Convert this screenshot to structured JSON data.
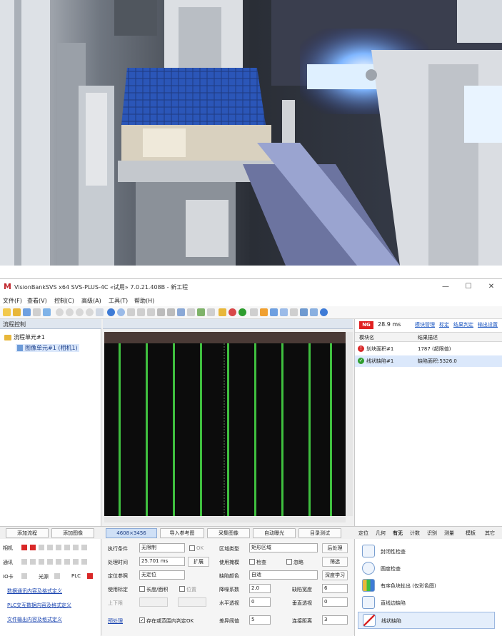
{
  "colors": {
    "ng_red": "#e02020",
    "ok_green": "#2e9d2e",
    "link_blue": "#1a44b0",
    "stripe_green": "#3fbf3f"
  },
  "photo": {
    "alt_icon": "machine-photo"
  },
  "window": {
    "title": "VisionBankSVS x64 SVS-PLUS-4C «试用» 7.0.21.408B - 新工程",
    "controls": [
      "—",
      "☐",
      "✕"
    ]
  },
  "menu": [
    "文件(F)",
    "查看(V)",
    "控制(C)",
    "高级(A)",
    "工具(T)",
    "帮助(H)"
  ],
  "left_panel": {
    "header": "流程控制",
    "tree_root": "流程单元#1",
    "tree_child": "图像单元#1 (相机1)"
  },
  "results": {
    "status": "NG",
    "time": "28.9 ms",
    "links": [
      "模块管理",
      "标定",
      "结果判定",
      "输出设置"
    ],
    "col_name": "模块名",
    "col_desc": "结果描述",
    "rows": [
      {
        "name": "划块面积#1",
        "value": "1787 (超限值)",
        "state": "ng"
      },
      {
        "name": "线状缺陷#1",
        "value": "缺陷面积:5326.0",
        "state": "ok"
      }
    ]
  },
  "bottom_bar": {
    "add_flow": "添加流程",
    "add_image": "添加图像",
    "resolution": "4608×3456",
    "import_ref": "导入参考图",
    "capture": "采集图像",
    "auto_exposure": "自动曝光",
    "dir_test": "目录测试",
    "tabs": [
      "定位",
      "几何",
      "有无",
      "计数",
      "识别",
      "测量",
      "模板",
      "其它"
    ]
  },
  "status": {
    "camera": "相机",
    "comm": "通讯",
    "io": "IO卡",
    "light": "光源",
    "plc": "PLC",
    "links": [
      "数据通讯内容及格式定义",
      "PLC交互数据内容及格式定义",
      "文件输出内容及格式定义"
    ]
  },
  "params": {
    "exec_cond_label": "执行条件",
    "exec_cond_value": "无限制",
    "ok_label": "OK",
    "time_label": "处理时间",
    "time_value": "25.701 ms",
    "expand_button": "扩展",
    "locate_ref_label": "定位参照",
    "locate_ref_value": "无定位",
    "use_calib_label": "使用标定",
    "calib_opt1": "长度/面积",
    "calib_opt2": "位置",
    "limits_label": "上下限",
    "pre_process": "预处理",
    "draw_in_range": "存在或范围内判定OK",
    "region_type_label": "区域类型",
    "region_type_value": "矩形区域",
    "post_process": "后处理",
    "use_mask_label": "使用掩模",
    "mask_opt1": "检查",
    "mask_opt2": "忽略",
    "filter_button": "筛选",
    "defect_color_label": "缺陷颜色",
    "defect_color_value": "自适",
    "deep_learning": "深度学习",
    "drop_coef_label": "降噪系数",
    "drop_coef_value": "2.0",
    "defect_width_label": "缺陷宽度",
    "defect_width_value": "6",
    "hthresh_label": "水平透视",
    "hthresh_value": "0",
    "vthresh_label": "垂直透视",
    "vthresh_value": "0",
    "thresh_label": "差异阈值",
    "thresh_value": "5",
    "conn_label": "连接距离",
    "conn_value": "3"
  },
  "tools": [
    {
      "label": "封闭性检查",
      "icon": "closure-icon"
    },
    {
      "label": "圆度检查",
      "icon": "roundness-icon"
    },
    {
      "label": "有序色块扯出 (仅彩色图)",
      "icon": "color-block-icon"
    },
    {
      "label": "直线边缺陷",
      "icon": "line-edge-icon"
    },
    {
      "label": "线状缺陷",
      "icon": "line-defect-icon"
    }
  ]
}
